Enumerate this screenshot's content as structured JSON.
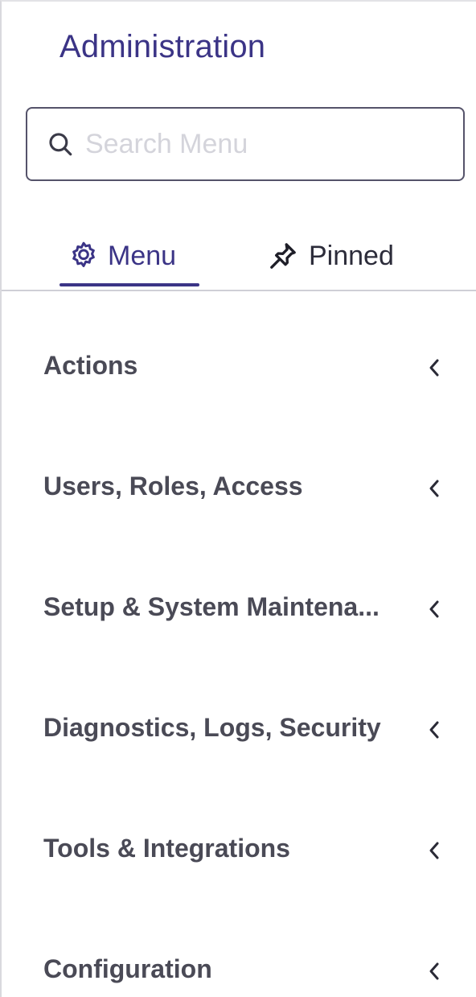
{
  "panel": {
    "title": "Administration"
  },
  "search": {
    "placeholder": "Search Menu",
    "value": "",
    "icon": "search-icon"
  },
  "tabs": [
    {
      "label": "Menu",
      "icon": "gear-icon",
      "active": true
    },
    {
      "label": "Pinned",
      "icon": "pin-icon",
      "active": false
    }
  ],
  "menu": {
    "items": [
      {
        "label": "Actions",
        "icon": "chevron-left-icon"
      },
      {
        "label": "Users, Roles, Access",
        "icon": "chevron-left-icon"
      },
      {
        "label": "Setup & System Maintena...",
        "icon": "chevron-left-icon"
      },
      {
        "label": "Diagnostics, Logs, Security",
        "icon": "chevron-left-icon"
      },
      {
        "label": "Tools & Integrations",
        "icon": "chevron-left-icon"
      },
      {
        "label": "Configuration",
        "icon": "chevron-left-icon"
      }
    ]
  },
  "colors": {
    "accent": "#3b3486",
    "text": "#4a4a56",
    "border": "#55536a",
    "placeholder": "#d4d4db"
  }
}
